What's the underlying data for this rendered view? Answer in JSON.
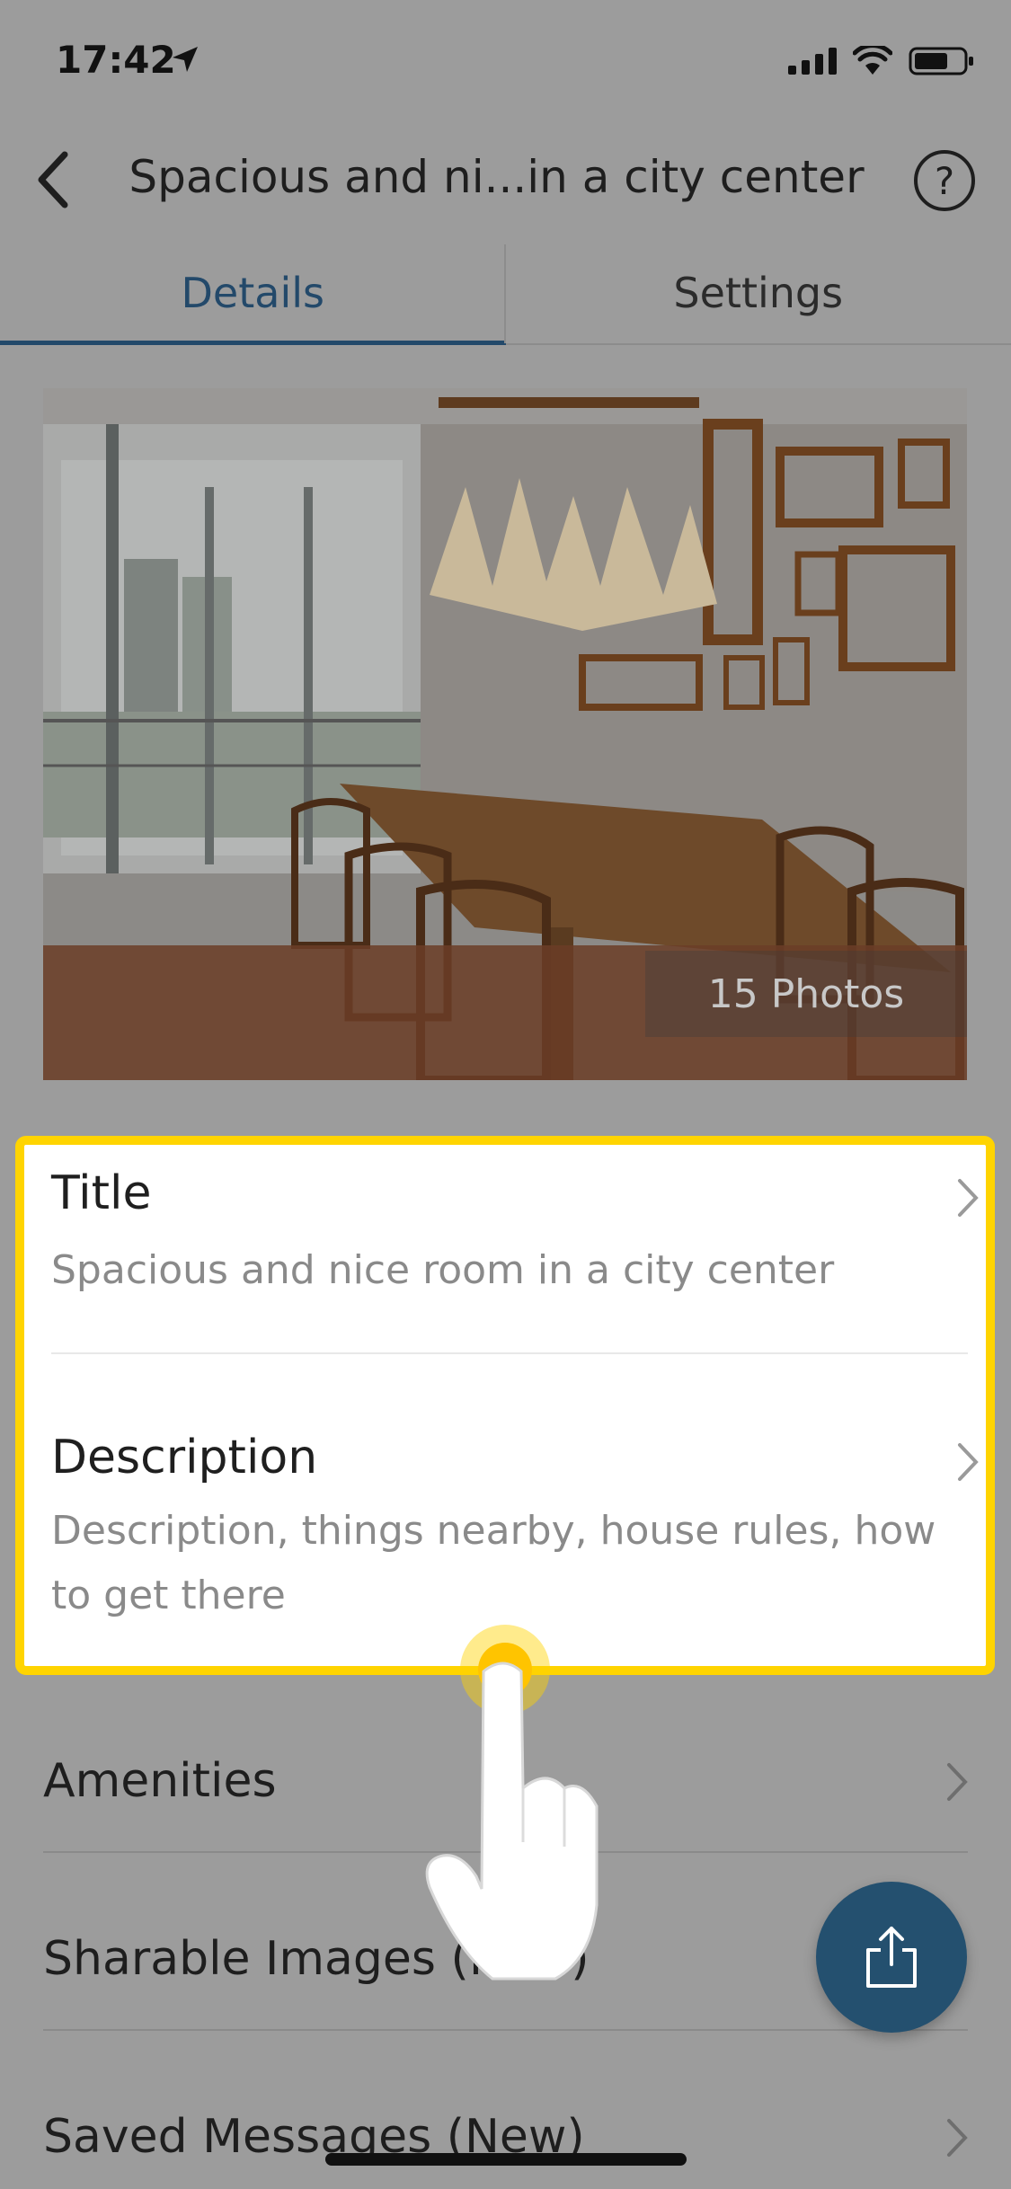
{
  "status_bar": {
    "time": "17:42"
  },
  "nav": {
    "title": "Spacious and ni...in a city center",
    "help_label": "?"
  },
  "tabs": [
    {
      "label": "Details",
      "active": true
    },
    {
      "label": "Settings",
      "active": false
    }
  ],
  "cover_photo": {
    "count_label": "15 Photos"
  },
  "card": {
    "title_row": {
      "title": "Title",
      "value": "Spacious and nice room in a city center"
    },
    "description_row": {
      "title": "Description",
      "value_line1": "Description, things nearby, house rules, how",
      "value_line2": "to get there"
    }
  },
  "list": [
    {
      "label": "Amenities"
    },
    {
      "label": "Sharable Images (New)"
    },
    {
      "label": "Saved Messages (New)"
    }
  ],
  "colors": {
    "accent": "#23496a",
    "highlight": "#ffd400",
    "fab": "#24506f",
    "overlay": "#9c9c9c"
  },
  "icons": {
    "back": "chevron-left-icon",
    "help": "question-circle-icon",
    "row": "chevron-right-icon",
    "fab": "share-icon"
  }
}
